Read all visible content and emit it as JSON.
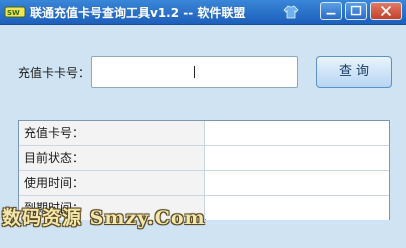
{
  "window": {
    "title": "联通充值卡号查询工具v1.2 --  软件联盟",
    "icons": {
      "app": "app-logo-icon",
      "skin": "shirt-icon",
      "minimize": "minimize-icon",
      "maximize": "maximize-icon",
      "close": "close-icon"
    }
  },
  "form": {
    "card_label": "充值卡卡号：",
    "card_value": "",
    "query_button": "查询"
  },
  "results": {
    "rows": [
      {
        "label": "充值卡号：",
        "value": ""
      },
      {
        "label": "目前状态：",
        "value": ""
      },
      {
        "label": "使用时间：",
        "value": ""
      },
      {
        "label": "到期时间：",
        "value": ""
      }
    ]
  },
  "watermark": {
    "text": "数码资源 Smzy.Com"
  },
  "colors": {
    "titlebar": "#2a6fc9",
    "background": "#cfe3f3",
    "button": "#b7d6f3",
    "close": "#c4402a"
  }
}
